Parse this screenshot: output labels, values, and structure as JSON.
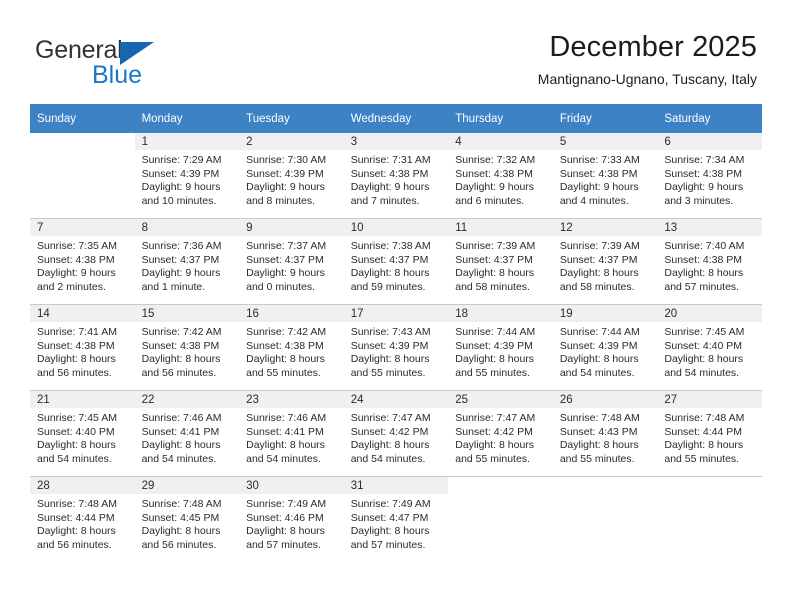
{
  "brand": {
    "name_primary": "General",
    "name_secondary": "Blue",
    "triangle_color": "#1567b2",
    "secondary_color": "#1a78c8"
  },
  "header": {
    "title": "December 2025",
    "subtitle": "Mantignano-Ugnano, Tuscany, Italy",
    "header_bg_color": "#3c82c4",
    "header_text_color": "#ffffff",
    "daynum_band_color": "#f0f0f0"
  },
  "weekdays": [
    "Sunday",
    "Monday",
    "Tuesday",
    "Wednesday",
    "Thursday",
    "Friday",
    "Saturday"
  ],
  "weeks": [
    [
      {
        "day": "",
        "lines": []
      },
      {
        "day": "1",
        "lines": [
          "Sunrise: 7:29 AM",
          "Sunset: 4:39 PM",
          "Daylight: 9 hours",
          "and 10 minutes."
        ]
      },
      {
        "day": "2",
        "lines": [
          "Sunrise: 7:30 AM",
          "Sunset: 4:39 PM",
          "Daylight: 9 hours",
          "and 8 minutes."
        ]
      },
      {
        "day": "3",
        "lines": [
          "Sunrise: 7:31 AM",
          "Sunset: 4:38 PM",
          "Daylight: 9 hours",
          "and 7 minutes."
        ]
      },
      {
        "day": "4",
        "lines": [
          "Sunrise: 7:32 AM",
          "Sunset: 4:38 PM",
          "Daylight: 9 hours",
          "and 6 minutes."
        ]
      },
      {
        "day": "5",
        "lines": [
          "Sunrise: 7:33 AM",
          "Sunset: 4:38 PM",
          "Daylight: 9 hours",
          "and 4 minutes."
        ]
      },
      {
        "day": "6",
        "lines": [
          "Sunrise: 7:34 AM",
          "Sunset: 4:38 PM",
          "Daylight: 9 hours",
          "and 3 minutes."
        ]
      }
    ],
    [
      {
        "day": "7",
        "lines": [
          "Sunrise: 7:35 AM",
          "Sunset: 4:38 PM",
          "Daylight: 9 hours",
          "and 2 minutes."
        ]
      },
      {
        "day": "8",
        "lines": [
          "Sunrise: 7:36 AM",
          "Sunset: 4:37 PM",
          "Daylight: 9 hours",
          "and 1 minute."
        ]
      },
      {
        "day": "9",
        "lines": [
          "Sunrise: 7:37 AM",
          "Sunset: 4:37 PM",
          "Daylight: 9 hours",
          "and 0 minutes."
        ]
      },
      {
        "day": "10",
        "lines": [
          "Sunrise: 7:38 AM",
          "Sunset: 4:37 PM",
          "Daylight: 8 hours",
          "and 59 minutes."
        ]
      },
      {
        "day": "11",
        "lines": [
          "Sunrise: 7:39 AM",
          "Sunset: 4:37 PM",
          "Daylight: 8 hours",
          "and 58 minutes."
        ]
      },
      {
        "day": "12",
        "lines": [
          "Sunrise: 7:39 AM",
          "Sunset: 4:37 PM",
          "Daylight: 8 hours",
          "and 58 minutes."
        ]
      },
      {
        "day": "13",
        "lines": [
          "Sunrise: 7:40 AM",
          "Sunset: 4:38 PM",
          "Daylight: 8 hours",
          "and 57 minutes."
        ]
      }
    ],
    [
      {
        "day": "14",
        "lines": [
          "Sunrise: 7:41 AM",
          "Sunset: 4:38 PM",
          "Daylight: 8 hours",
          "and 56 minutes."
        ]
      },
      {
        "day": "15",
        "lines": [
          "Sunrise: 7:42 AM",
          "Sunset: 4:38 PM",
          "Daylight: 8 hours",
          "and 56 minutes."
        ]
      },
      {
        "day": "16",
        "lines": [
          "Sunrise: 7:42 AM",
          "Sunset: 4:38 PM",
          "Daylight: 8 hours",
          "and 55 minutes."
        ]
      },
      {
        "day": "17",
        "lines": [
          "Sunrise: 7:43 AM",
          "Sunset: 4:39 PM",
          "Daylight: 8 hours",
          "and 55 minutes."
        ]
      },
      {
        "day": "18",
        "lines": [
          "Sunrise: 7:44 AM",
          "Sunset: 4:39 PM",
          "Daylight: 8 hours",
          "and 55 minutes."
        ]
      },
      {
        "day": "19",
        "lines": [
          "Sunrise: 7:44 AM",
          "Sunset: 4:39 PM",
          "Daylight: 8 hours",
          "and 54 minutes."
        ]
      },
      {
        "day": "20",
        "lines": [
          "Sunrise: 7:45 AM",
          "Sunset: 4:40 PM",
          "Daylight: 8 hours",
          "and 54 minutes."
        ]
      }
    ],
    [
      {
        "day": "21",
        "lines": [
          "Sunrise: 7:45 AM",
          "Sunset: 4:40 PM",
          "Daylight: 8 hours",
          "and 54 minutes."
        ]
      },
      {
        "day": "22",
        "lines": [
          "Sunrise: 7:46 AM",
          "Sunset: 4:41 PM",
          "Daylight: 8 hours",
          "and 54 minutes."
        ]
      },
      {
        "day": "23",
        "lines": [
          "Sunrise: 7:46 AM",
          "Sunset: 4:41 PM",
          "Daylight: 8 hours",
          "and 54 minutes."
        ]
      },
      {
        "day": "24",
        "lines": [
          "Sunrise: 7:47 AM",
          "Sunset: 4:42 PM",
          "Daylight: 8 hours",
          "and 54 minutes."
        ]
      },
      {
        "day": "25",
        "lines": [
          "Sunrise: 7:47 AM",
          "Sunset: 4:42 PM",
          "Daylight: 8 hours",
          "and 55 minutes."
        ]
      },
      {
        "day": "26",
        "lines": [
          "Sunrise: 7:48 AM",
          "Sunset: 4:43 PM",
          "Daylight: 8 hours",
          "and 55 minutes."
        ]
      },
      {
        "day": "27",
        "lines": [
          "Sunrise: 7:48 AM",
          "Sunset: 4:44 PM",
          "Daylight: 8 hours",
          "and 55 minutes."
        ]
      }
    ],
    [
      {
        "day": "28",
        "lines": [
          "Sunrise: 7:48 AM",
          "Sunset: 4:44 PM",
          "Daylight: 8 hours",
          "and 56 minutes."
        ]
      },
      {
        "day": "29",
        "lines": [
          "Sunrise: 7:48 AM",
          "Sunset: 4:45 PM",
          "Daylight: 8 hours",
          "and 56 minutes."
        ]
      },
      {
        "day": "30",
        "lines": [
          "Sunrise: 7:49 AM",
          "Sunset: 4:46 PM",
          "Daylight: 8 hours",
          "and 57 minutes."
        ]
      },
      {
        "day": "31",
        "lines": [
          "Sunrise: 7:49 AM",
          "Sunset: 4:47 PM",
          "Daylight: 8 hours",
          "and 57 minutes."
        ]
      },
      {
        "day": "",
        "lines": []
      },
      {
        "day": "",
        "lines": []
      },
      {
        "day": "",
        "lines": []
      }
    ]
  ]
}
